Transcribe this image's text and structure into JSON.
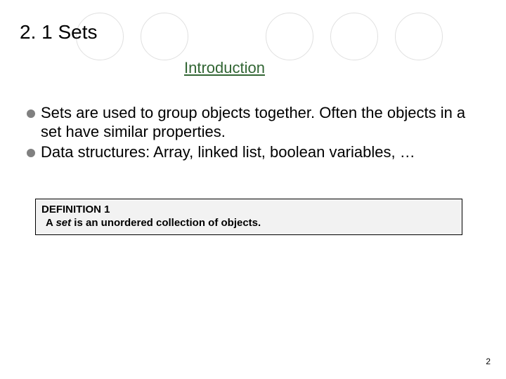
{
  "heading": "2. 1 Sets",
  "subtitle": "Introduction",
  "bullets": [
    "Sets are used to group objects together. Often the objects in a set have similar properties.",
    "Data structures: Array, linked list, boolean variables, …"
  ],
  "definition": {
    "title": "DEFINITION 1",
    "body_prefix": " A ",
    "body_italic": "set",
    "body_suffix": " is an unordered collection of objects."
  },
  "page_number": "2"
}
